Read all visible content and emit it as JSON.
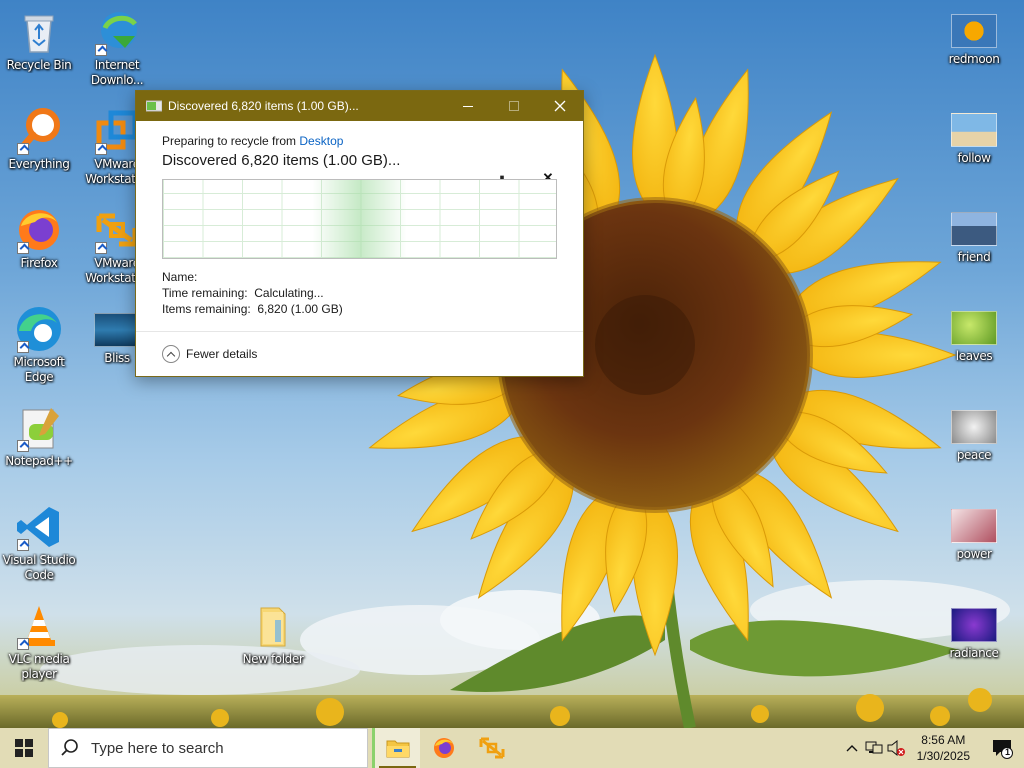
{
  "desktop": {
    "left_icons": [
      {
        "label": "Recycle Bin",
        "icon": "recycle-bin-icon"
      },
      {
        "label": "Everything",
        "icon": "everything-search-icon"
      },
      {
        "label": "Firefox",
        "icon": "firefox-icon"
      },
      {
        "label": "Microsoft Edge",
        "icon": "edge-icon"
      },
      {
        "label": "Notepad++",
        "icon": "notepadpp-icon"
      },
      {
        "label": "Visual Studio Code",
        "icon": "vscode-icon"
      },
      {
        "label": "VLC media player",
        "icon": "vlc-icon"
      }
    ],
    "second_column_icons": [
      {
        "label": "Internet Downlo...",
        "icon": "idm-icon"
      },
      {
        "label": "VMware Workstati...",
        "icon": "vmware-icon"
      },
      {
        "label": "VMware Workstati...",
        "icon": "vmware-player-icon"
      },
      {
        "label": "Bliss",
        "icon": "bliss-image-icon"
      }
    ],
    "new_folder": {
      "label": "New folder",
      "icon": "folder-icon"
    },
    "right_icons": [
      {
        "label": "redmoon",
        "icon": "redmoon-image-icon"
      },
      {
        "label": "follow",
        "icon": "follow-image-icon"
      },
      {
        "label": "friend",
        "icon": "friend-image-icon"
      },
      {
        "label": "leaves",
        "icon": "leaves-image-icon"
      },
      {
        "label": "peace",
        "icon": "peace-image-icon"
      },
      {
        "label": "power",
        "icon": "power-image-icon"
      },
      {
        "label": "radiance",
        "icon": "radiance-image-icon"
      }
    ]
  },
  "dialog": {
    "title": "Discovered 6,820 items (1.00 GB)...",
    "preparing_prefix": "Preparing to recycle from ",
    "preparing_location": "Desktop",
    "headline": "Discovered 6,820 items (1.00 GB)...",
    "pause_glyph": "⏸",
    "cancel_glyph": "✕",
    "name_label": "Name:",
    "time_remaining_label": "Time remaining:",
    "time_remaining_value": "Calculating...",
    "items_remaining_label": "Items remaining:",
    "items_remaining_value": "6,820 (1.00 GB)",
    "fewer_details": "Fewer details",
    "accent_color": "#7b6810"
  },
  "taskbar": {
    "search_placeholder": "Type here to search",
    "apps": [
      {
        "name": "File Explorer",
        "icon": "file-explorer-icon",
        "active": true
      },
      {
        "name": "Firefox",
        "icon": "firefox-icon",
        "active": false
      },
      {
        "name": "VMware",
        "icon": "vmware-icon",
        "active": false
      }
    ],
    "time": "8:56 AM",
    "date": "1/30/2025",
    "notification_count": "1",
    "color": "#e2dcb6"
  }
}
